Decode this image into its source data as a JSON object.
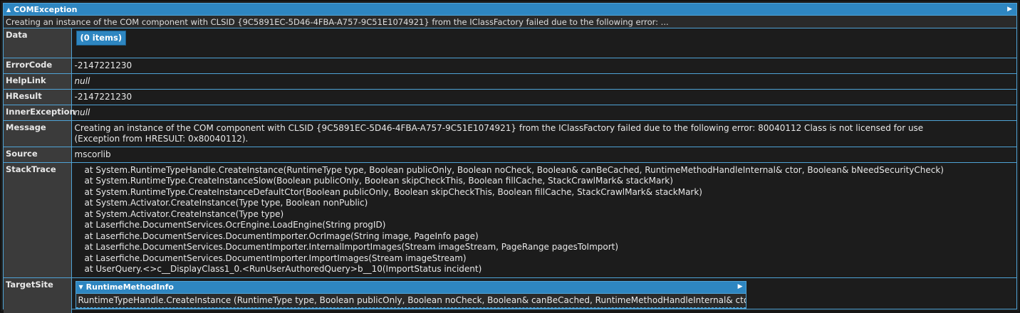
{
  "header": {
    "title": "COMException",
    "summary": "Creating an instance of the COM component with CLSID {9C5891EC-5D46-4FBA-A757-9C51E1074921} from the IClassFactory failed due to the following error: ..."
  },
  "labels": {
    "data": "Data",
    "errorcode": "ErrorCode",
    "helplink": "HelpLink",
    "hresult": "HResult",
    "innerexception": "InnerException",
    "message": "Message",
    "source": "Source",
    "stacktrace": "StackTrace",
    "targetsite": "TargetSite"
  },
  "values": {
    "data_items": "(0 items)",
    "errorcode": "-2147221230",
    "helplink": "null",
    "hresult": "-2147221230",
    "innerexception": "null",
    "message_line1": "Creating an instance of the COM component with CLSID {9C5891EC-5D46-4FBA-A757-9C51E1074921} from the IClassFactory failed due to the following error: 80040112 Class is not licensed for use",
    "message_line2": "(Exception from HRESULT: 0x80040112).",
    "source": "mscorlib"
  },
  "stacktrace": [
    "at System.RuntimeTypeHandle.CreateInstance(RuntimeType type, Boolean publicOnly, Boolean noCheck, Boolean& canBeCached, RuntimeMethodHandleInternal& ctor, Boolean& bNeedSecurityCheck)",
    "at System.RuntimeType.CreateInstanceSlow(Boolean publicOnly, Boolean skipCheckThis, Boolean fillCache, StackCrawlMark& stackMark)",
    "at System.RuntimeType.CreateInstanceDefaultCtor(Boolean publicOnly, Boolean skipCheckThis, Boolean fillCache, StackCrawlMark& stackMark)",
    "at System.Activator.CreateInstance(Type type, Boolean nonPublic)",
    "at System.Activator.CreateInstance(Type type)",
    "at Laserfiche.DocumentServices.OcrEngine.LoadEngine(String progID)",
    "at Laserfiche.DocumentServices.DocumentImporter.OcrImage(String image, PageInfo page)",
    "at Laserfiche.DocumentServices.DocumentImporter.InternalImportImages(Stream imageStream, PageRange pagesToImport)",
    "at Laserfiche.DocumentServices.DocumentImporter.ImportImages(Stream imageStream)",
    "at UserQuery.<>c__DisplayClass1_0.<RunUserAuthoredQuery>b__10(ImportStatus incident)"
  ],
  "targetsite": {
    "title": "RuntimeMethodInfo",
    "summary": "RuntimeTypeHandle.CreateInstance (RuntimeType type, Boolean publicOnly, Boolean noCheck, Boolean& canBeCached, RuntimeMethodHandleInternal& ctor, Bool..."
  },
  "icons": {
    "collapse": "triangle-up-icon",
    "expand_right": "triangle-right-icon",
    "expand_down": "triangle-down-icon"
  }
}
